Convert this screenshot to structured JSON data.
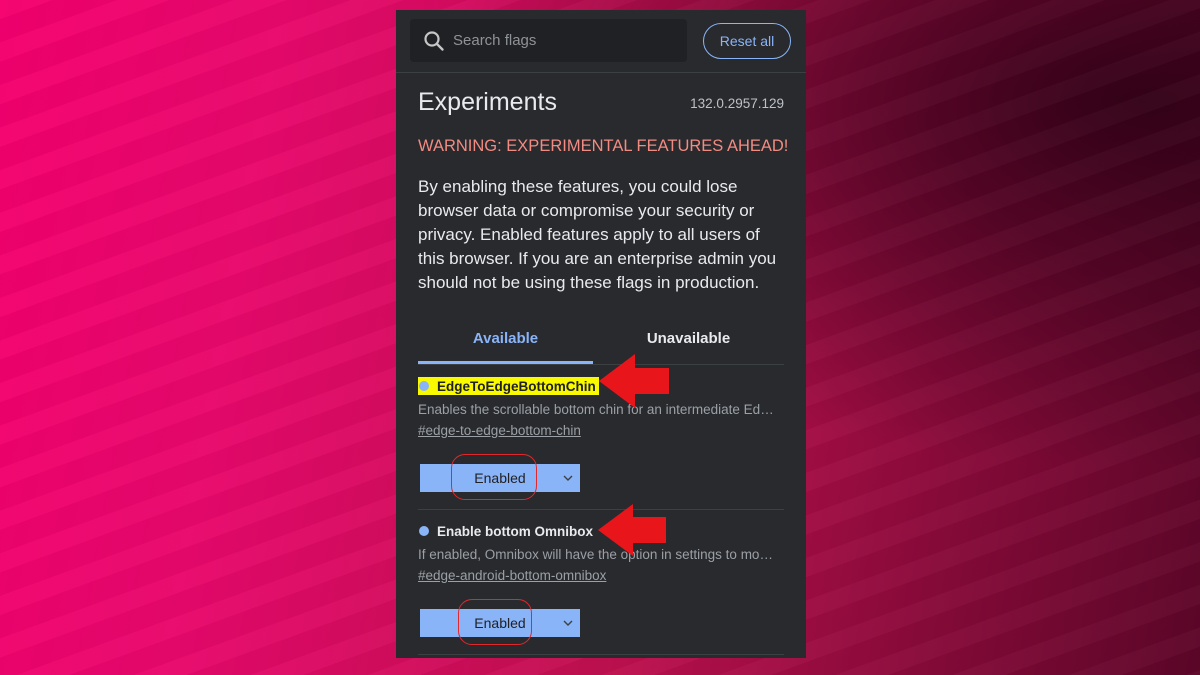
{
  "search": {
    "placeholder": "Search flags"
  },
  "toolbar": {
    "reset_label": "Reset all"
  },
  "page": {
    "title": "Experiments",
    "version": "132.0.2957.129",
    "warning": "WARNING: EXPERIMENTAL FEATURES AHEAD!",
    "description": "By enabling these features, you could lose browser data or compromise your security or privacy. Enabled features apply to all users of this browser. If you are an enterprise admin you should not be using these flags in production."
  },
  "tabs": [
    {
      "label": "Available",
      "selected": true
    },
    {
      "label": "Unavailable",
      "selected": false
    }
  ],
  "flags": [
    {
      "name": "EdgeToEdgeBottomChin",
      "description": "Enables the scrollable bottom chin for an intermediate Ed…",
      "link": "#edge-to-edge-bottom-chin",
      "value": "Enabled",
      "highlighted": true
    },
    {
      "name": "Enable bottom Omnibox",
      "description": "If enabled, Omnibox will have the option in settings to mo…",
      "link": "#edge-android-bottom-omnibox",
      "value": "Enabled",
      "highlighted": false
    }
  ],
  "colors": {
    "accent": "#8ab4f8",
    "warning": "#f28b82",
    "highlight": "#f9f900",
    "annotation": "#e0282c"
  },
  "icons": [
    "search-icon",
    "chevron-down-icon",
    "flag-dot-icon",
    "annotation-arrow-icon"
  ]
}
